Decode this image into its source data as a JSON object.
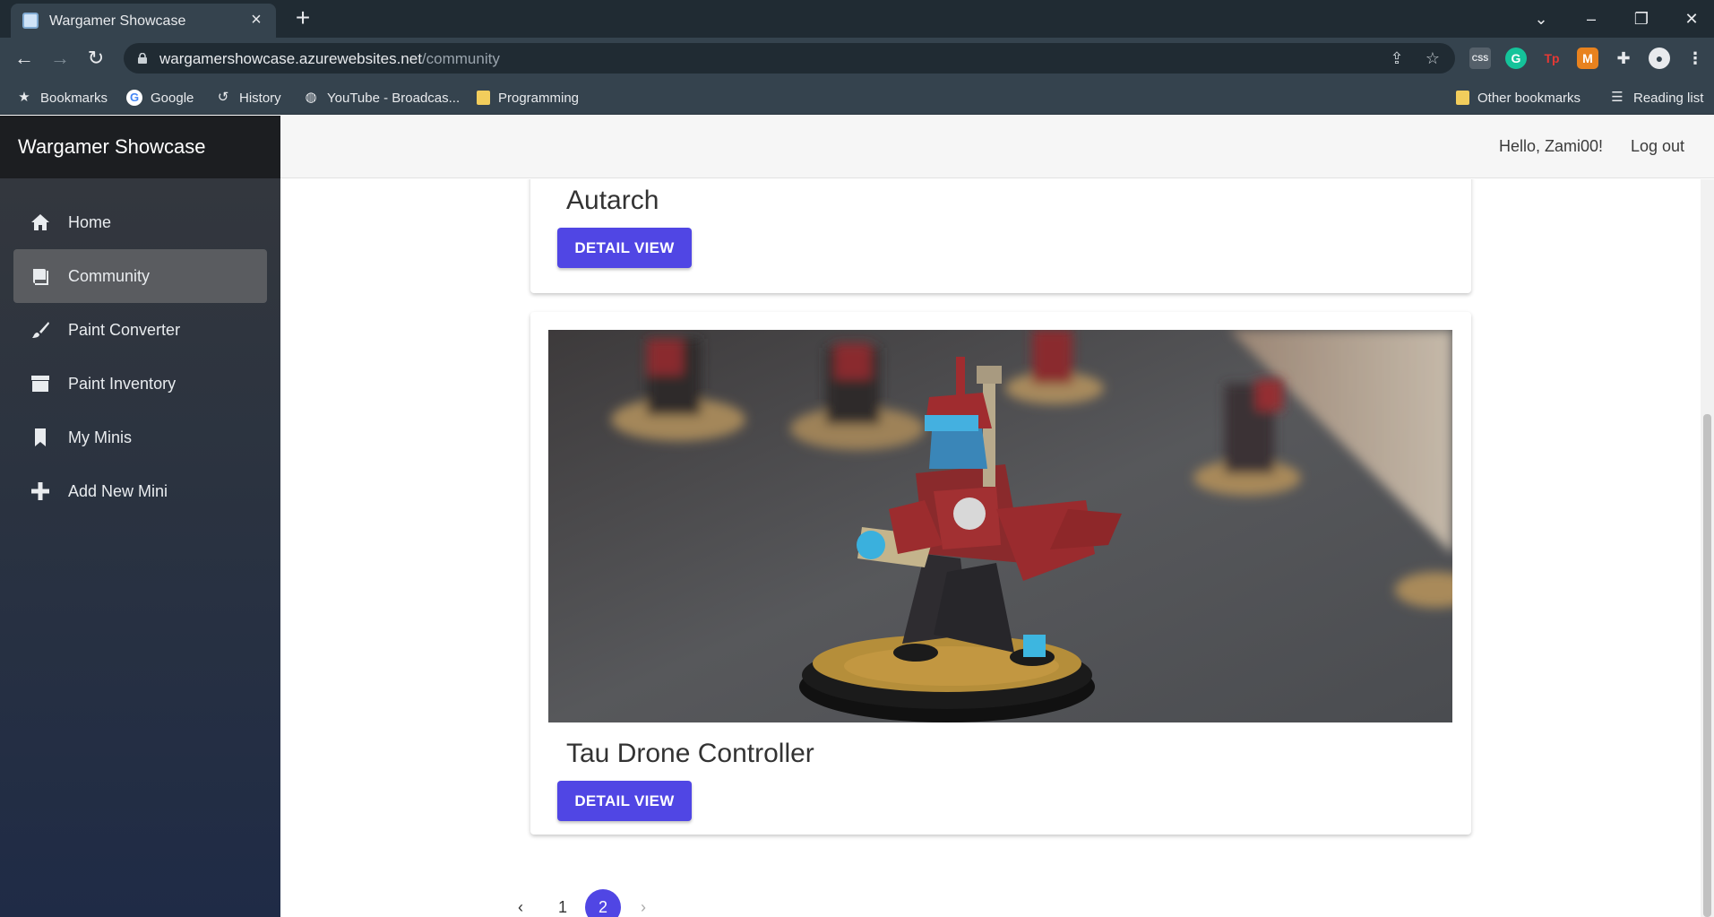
{
  "browser": {
    "tab_title": "Wargamer Showcase",
    "url_host": "wargamershowcase.azurewebsites.net",
    "url_path": "/community",
    "bookmarks": [
      {
        "label": "Bookmarks",
        "icon": "star-icon"
      },
      {
        "label": "Google",
        "icon": "google-icon"
      },
      {
        "label": "History",
        "icon": "history-icon"
      },
      {
        "label": "YouTube - Broadcas...",
        "icon": "globe-icon"
      },
      {
        "label": "Programming",
        "icon": "folder-icon"
      }
    ],
    "other_bookmarks": "Other bookmarks",
    "reading_list": "Reading list"
  },
  "app": {
    "brand": "Wargamer Showcase",
    "nav": [
      {
        "label": "Home",
        "icon": "home-icon",
        "active": false
      },
      {
        "label": "Community",
        "icon": "book-icon",
        "active": true
      },
      {
        "label": "Paint Converter",
        "icon": "brush-icon",
        "active": false
      },
      {
        "label": "Paint Inventory",
        "icon": "archive-icon",
        "active": false
      },
      {
        "label": "My Minis",
        "icon": "bookmark-icon",
        "active": false
      },
      {
        "label": "Add New Mini",
        "icon": "plus-icon",
        "active": false
      }
    ],
    "header": {
      "greeting": "Hello, Zami00!",
      "logout": "Log out"
    }
  },
  "cards": [
    {
      "title": "Autarch",
      "button": "DETAIL VIEW"
    },
    {
      "title": "Tau Drone Controller",
      "button": "DETAIL VIEW"
    }
  ],
  "pagination": {
    "pages": [
      "1",
      "2"
    ],
    "current": "2"
  },
  "colors": {
    "accent": "#5046e4",
    "sidebar_top": "#35383d",
    "sidebar_bottom": "#1f2b46"
  }
}
